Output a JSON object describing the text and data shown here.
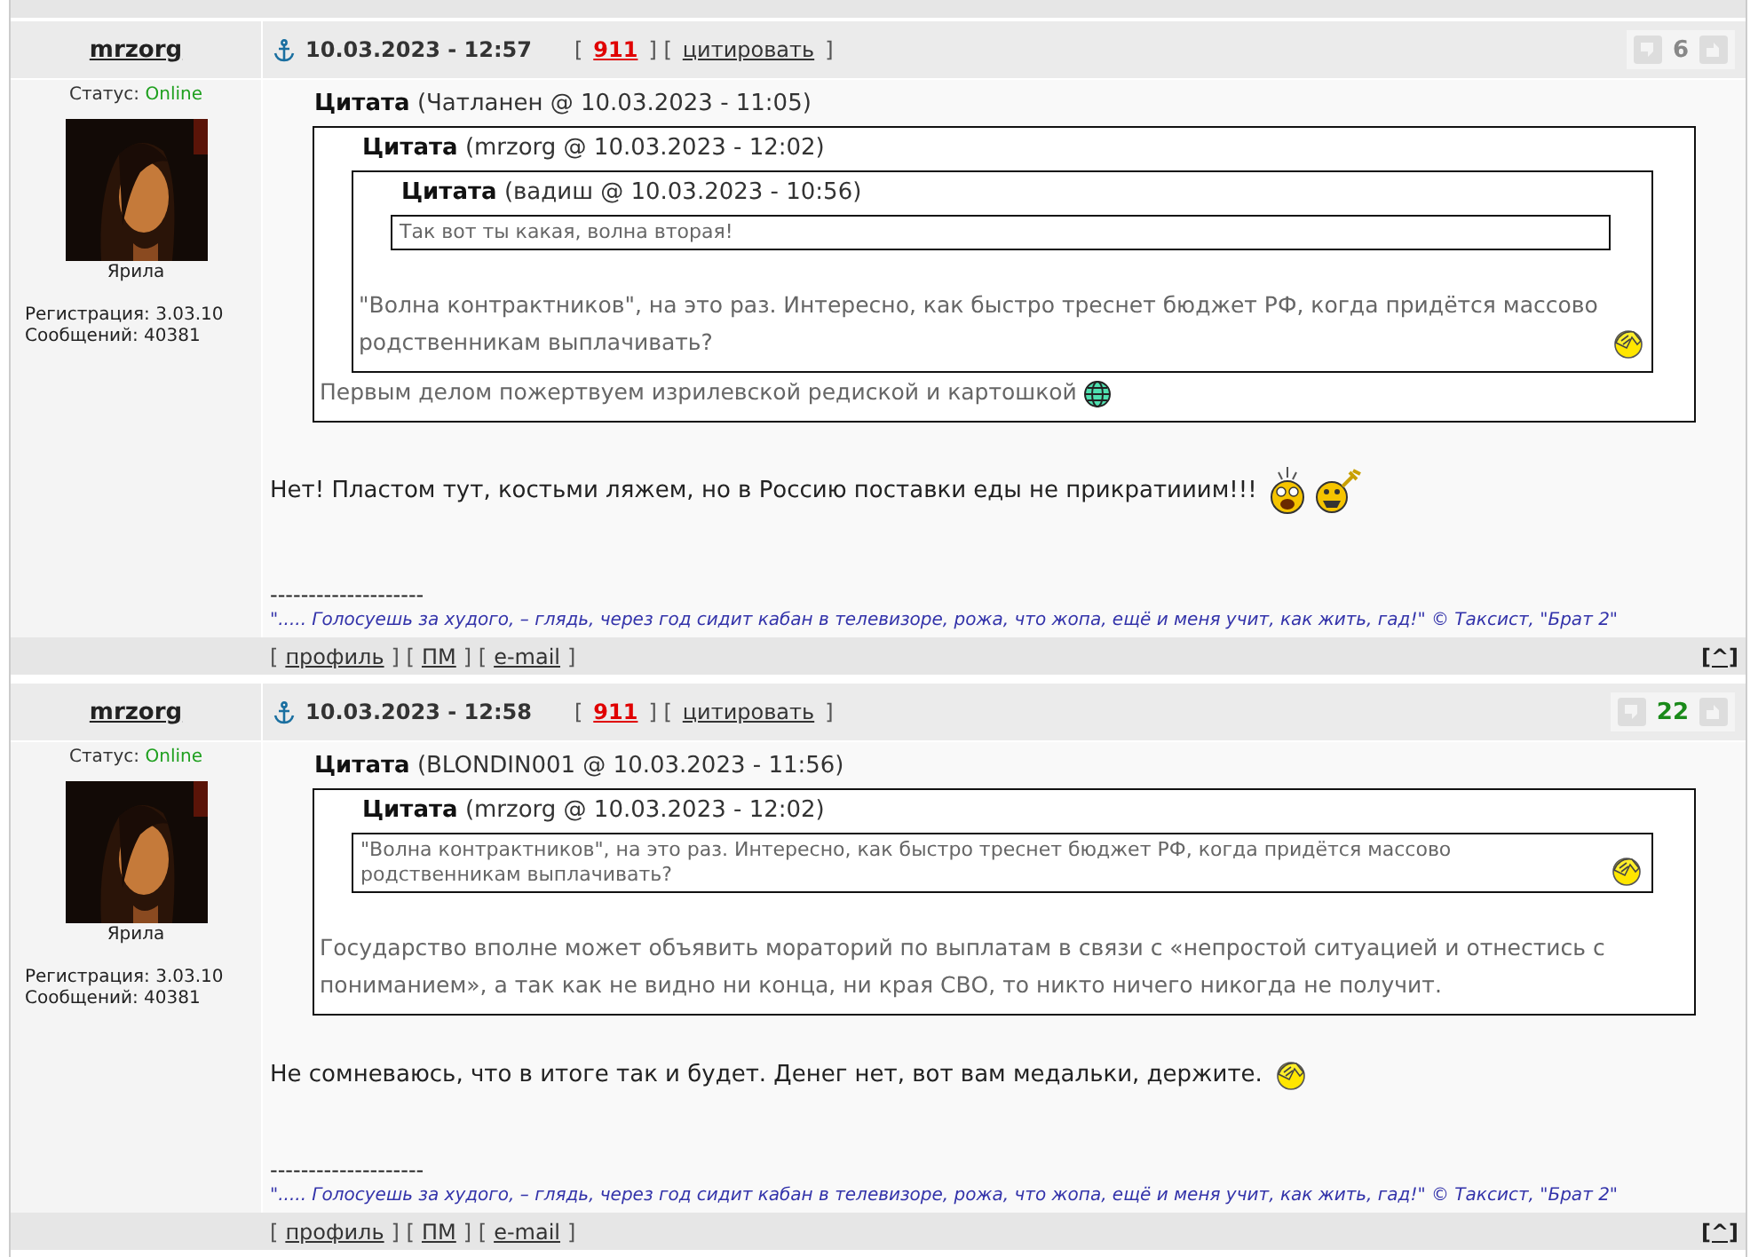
{
  "posts": [
    {
      "author": "mrzorg",
      "status_label": "Статус:",
      "status": "Online",
      "avatar_caption": "Ярила",
      "registration": "Регистрация: 3.03.10",
      "messages": "Сообщений: 40381",
      "date": "10.03.2023 - 12:57",
      "header_links": [
        {
          "kind": "bracket",
          "text": "["
        },
        {
          "kind": "rep",
          "text": "911"
        },
        {
          "kind": "bracket",
          "text": "] ["
        },
        {
          "kind": "link",
          "text": "цитировать"
        },
        {
          "kind": "bracket",
          "text": "]"
        }
      ],
      "rating": {
        "value": "6",
        "positive": false
      },
      "quote": {
        "label": "Цитата",
        "source": "(Чатланен @ 10.03.2023 - 11:05)",
        "inner": {
          "label": "Цитата",
          "source": "(mrzorg @ 10.03.2023 - 12:02)",
          "inner": {
            "label": "Цитата",
            "source": "(вадиш @ 10.03.2023 - 10:56)",
            "text": "Так вот ты какая, волна вторая!"
          },
          "text": "\"Волна контрактников\", на это раз. Интересно, как быстро треснет бюджет РФ, когда придётся массово родственникам выплачивать?",
          "smiley": {
            "kind": "facepalm"
          }
        },
        "text": "Первым делом пожертвуем изрилевской редиской и картошкой",
        "smiley": {
          "kind": "globe"
        }
      },
      "message": "Нет! Пластом тут, костьми ляжем, но в Россию поставки еды не прикратииим!!!",
      "smileys": [
        {
          "kind": "shocked"
        },
        {
          "kind": "rocker"
        }
      ],
      "signature_divider": "--------------------",
      "signature": "\"..... Голосуешь за худого, – глядь, через год сидит кабан в телевизоре, рожа, что жопа, ещё и меня учит, как жить, гад!\" © Таксист, \"Брат 2\"",
      "footer_links": [
        {
          "kind": "bracket",
          "text": "["
        },
        {
          "kind": "link",
          "text": "профиль"
        },
        {
          "kind": "bracket",
          "text": "] ["
        },
        {
          "kind": "link",
          "text": "ПМ"
        },
        {
          "kind": "bracket",
          "text": "] ["
        },
        {
          "kind": "link",
          "text": "e-mail"
        },
        {
          "kind": "bracket",
          "text": "]"
        }
      ],
      "top_link": "[^]"
    },
    {
      "author": "mrzorg",
      "status_label": "Статус:",
      "status": "Online",
      "avatar_caption": "Ярила",
      "registration": "Регистрация: 3.03.10",
      "messages": "Сообщений: 40381",
      "date": "10.03.2023 - 12:58",
      "header_links": [
        {
          "kind": "bracket",
          "text": "["
        },
        {
          "kind": "rep",
          "text": "911"
        },
        {
          "kind": "bracket",
          "text": "] ["
        },
        {
          "kind": "link",
          "text": "цитировать"
        },
        {
          "kind": "bracket",
          "text": "]"
        }
      ],
      "rating": {
        "value": "22",
        "positive": true
      },
      "quote": {
        "label": "Цитата",
        "source": "(BLONDIN001 @ 10.03.2023 - 11:56)",
        "inner": {
          "label": "Цитата",
          "source": "(mrzorg @ 10.03.2023 - 12:02)",
          "text": "\"Волна контрактников\", на это раз. Интересно, как быстро треснет бюджет РФ, когда придётся массово родственникам выплачивать?",
          "smiley": {
            "kind": "facepalm"
          }
        },
        "text": "Государство вполне может объявить мораторий по выплатам в связи с «непростой ситуацией и отнестись с пониманием», а так как не видно ни конца, ни края СВО, то никто ничего никогда не получит."
      },
      "message": "Не сомневаюсь, что в итоге так и будет. Денег нет, вот вам медальки, держите.",
      "smileys": [
        {
          "kind": "facepalm"
        }
      ],
      "signature_divider": "--------------------",
      "signature": "\"..... Голосуешь за худого, – глядь, через год сидит кабан в телевизоре, рожа, что жопа, ещё и меня учит, как жить, гад!\" © Таксист, \"Брат 2\"",
      "footer_links": [
        {
          "kind": "bracket",
          "text": "["
        },
        {
          "kind": "link",
          "text": "профиль"
        },
        {
          "kind": "bracket",
          "text": "] ["
        },
        {
          "kind": "link",
          "text": "ПМ"
        },
        {
          "kind": "bracket",
          "text": "] ["
        },
        {
          "kind": "link",
          "text": "e-mail"
        },
        {
          "kind": "bracket",
          "text": "]"
        }
      ],
      "top_link": "[^]"
    }
  ]
}
